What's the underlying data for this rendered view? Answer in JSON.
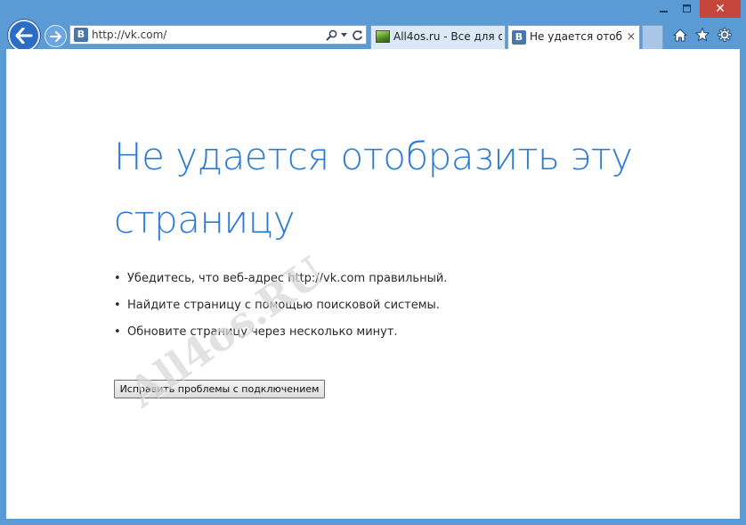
{
  "window": {
    "minimize_glyph": "—",
    "close_glyph": "✕"
  },
  "address_bar": {
    "url": "http://vk.com/",
    "favicon_letter": "B"
  },
  "tabs": [
    {
      "label": "All4os.ru - Все для о...",
      "favicon": "all4os-favicon",
      "active": false
    },
    {
      "label": "Не удается отобр...",
      "favicon_letter": "B",
      "active": true,
      "close_glyph": "×"
    }
  ],
  "error_page": {
    "title": "Не удается отобразить эту страницу",
    "bullet": "•",
    "suggestions": [
      "Убедитесь, что веб-адрес http://vk.com правильный.",
      "Найдите страницу с помощью поисковой системы.",
      "Обновите страницу через несколько минут."
    ],
    "fix_button_label": "Исправить проблемы с подключением"
  },
  "watermark": "All4os.RU",
  "colors": {
    "frame": "#5b9bd5",
    "title_blue": "#2d7cd3",
    "close_red": "#c7463b",
    "vk_blue": "#4a76a8"
  },
  "icons": {
    "back": "back-arrow-icon",
    "forward": "forward-arrow-icon",
    "search": "search-icon",
    "refresh": "refresh-icon",
    "home": "home-icon",
    "favorites": "star-icon",
    "tools": "gear-icon"
  }
}
